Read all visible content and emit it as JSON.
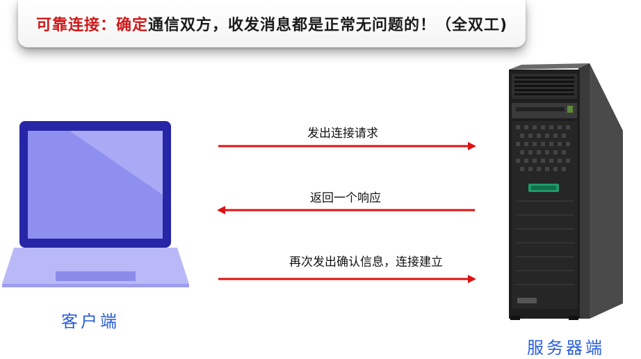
{
  "banner": {
    "part1": "可靠连接：",
    "part2": "确定",
    "part3": "通信双方，收发消息都是正常无问题的！（全双工)"
  },
  "messages": [
    {
      "text": "发出连接请求",
      "direction": "right"
    },
    {
      "text": "返回一个响应",
      "direction": "left"
    },
    {
      "text": "再次发出确认信息，连接建立",
      "direction": "right"
    }
  ],
  "client": {
    "label": "客户端"
  },
  "server": {
    "label": "服务器端"
  },
  "colors": {
    "accent": "#d01818",
    "arrow": "#e01010",
    "laptop": "#2a2aa8",
    "hand": "#2a5fd8"
  }
}
